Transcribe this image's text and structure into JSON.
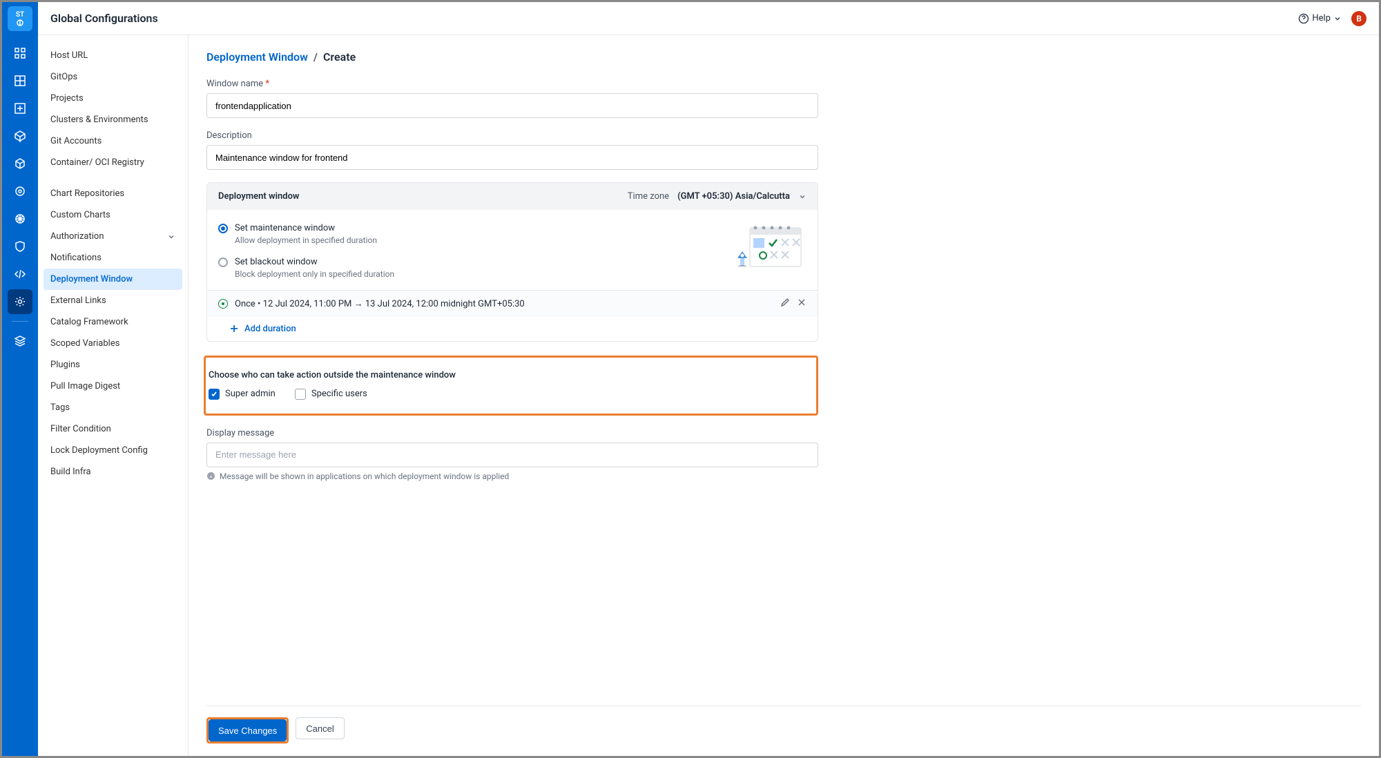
{
  "header": {
    "title": "Global Configurations",
    "help": "Help",
    "avatar_initial": "B"
  },
  "rail_logo": "ST",
  "sidebar": {
    "items": [
      {
        "label": "Host URL"
      },
      {
        "label": "GitOps"
      },
      {
        "label": "Projects"
      },
      {
        "label": "Clusters & Environments"
      },
      {
        "label": "Git Accounts"
      },
      {
        "label": "Container/ OCI Registry"
      },
      {
        "label": "Chart Repositories",
        "spacer": true
      },
      {
        "label": "Custom Charts"
      },
      {
        "label": "Authorization",
        "expandable": true
      },
      {
        "label": "Notifications"
      },
      {
        "label": "Deployment Window",
        "active": true
      },
      {
        "label": "External Links"
      },
      {
        "label": "Catalog Framework"
      },
      {
        "label": "Scoped Variables"
      },
      {
        "label": "Plugins"
      },
      {
        "label": "Pull Image Digest"
      },
      {
        "label": "Tags"
      },
      {
        "label": "Filter Condition"
      },
      {
        "label": "Lock Deployment Config"
      },
      {
        "label": "Build Infra"
      }
    ]
  },
  "breadcrumb": {
    "parent": "Deployment Window",
    "current": "Create"
  },
  "form": {
    "window_name_label": "Window name",
    "window_name_value": "frontendapplication",
    "description_label": "Description",
    "description_value": "Maintenance window for frontend",
    "panel_title": "Deployment window",
    "time_zone_label": "Time zone",
    "time_zone_value": "(GMT +05:30) Asia/Calcutta",
    "radio1_title": "Set maintenance window",
    "radio1_sub": "Allow deployment in specified duration",
    "radio2_title": "Set blackout window",
    "radio2_sub": "Block deployment only in specified duration",
    "duration_prefix": "Once",
    "duration_text": "12 Jul 2024, 11:00 PM → 13 Jul 2024, 12:00 midnight GMT+05:30",
    "add_duration": "Add duration",
    "permission_title": "Choose who can take action outside the maintenance window",
    "permission_super_admin": "Super admin",
    "permission_specific": "Specific users",
    "display_msg_label": "Display message",
    "display_msg_placeholder": "Enter message here",
    "display_msg_hint": "Message will be shown in applications on which deployment window is applied",
    "save_label": "Save Changes",
    "cancel_label": "Cancel"
  }
}
